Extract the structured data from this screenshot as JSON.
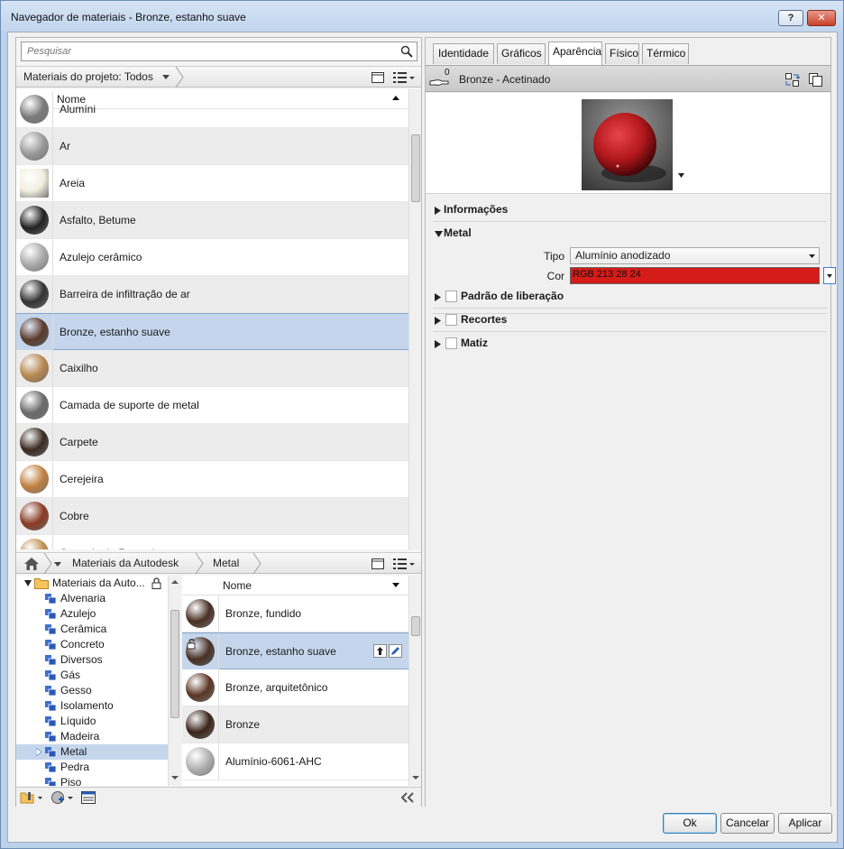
{
  "window": {
    "title": "Navegador de materiais - Bronze, estanho suave",
    "help_label": "?",
    "close_label": "✕"
  },
  "search": {
    "placeholder": "Pesquisar"
  },
  "project_bar": {
    "filter_label": "Materiais do projeto: Todos"
  },
  "project_list": {
    "header": "Nome",
    "items": [
      {
        "label": "Alumíni",
        "thumb": "#7a7a7a"
      },
      {
        "label": "Ar",
        "thumb": "#9a9a9a"
      },
      {
        "label": "Areia",
        "thumb": "#f2efe0"
      },
      {
        "label": "Asfalto, Betume",
        "thumb": "#222222"
      },
      {
        "label": "Azulejo cerâmico",
        "thumb": "#a9a9a9"
      },
      {
        "label": "Barreira de infiltração de ar",
        "thumb": "#333333"
      },
      {
        "label": "Bronze, estanho suave",
        "thumb": "#5a3a2a"
      },
      {
        "label": "Caixilho",
        "thumb": "#b88850"
      },
      {
        "label": "Camada de suporte de metal",
        "thumb": "#6a6a6a"
      },
      {
        "label": "Carpete",
        "thumb": "#3a2a22"
      },
      {
        "label": "Cerejeira",
        "thumb": "#c08040"
      },
      {
        "label": "Cobre",
        "thumb": "#8a3a22"
      },
      {
        "label": "Camada de Revestimento",
        "thumb": "#c09050"
      }
    ]
  },
  "library_bar": {
    "crumb1": "Materiais da Autodesk",
    "crumb2": "Metal"
  },
  "tree": {
    "root": "Materiais da Auto...",
    "items": [
      "Alvenaria",
      "Azulejo",
      "Cerâmica",
      "Concreto",
      "Diversos",
      "Gás",
      "Gesso",
      "Isolamento",
      "Líquido",
      "Madeira",
      "Metal",
      "Pedra",
      "Piso"
    ],
    "selected": "Metal"
  },
  "library_list": {
    "header": "Nome",
    "items": [
      {
        "label": "Bronze, fundido",
        "thumb": "#4a3024"
      },
      {
        "label": "Bronze, estanho suave",
        "thumb": "#4a3024"
      },
      {
        "label": "Bronze, arquitetônico",
        "thumb": "#5a3424"
      },
      {
        "label": "Bronze",
        "thumb": "#3a2418"
      },
      {
        "label": "Alumínio-6061-AHC",
        "thumb": "#b0b0b0"
      }
    ]
  },
  "tabs": [
    "Identidade",
    "Gráficos",
    "Aparência",
    "Físico",
    "Térmico"
  ],
  "active_tab": "Aparência",
  "asset": {
    "count": "0",
    "title": "Bronze - Acetinado"
  },
  "sections": {
    "info": "Informações",
    "metal": "Metal",
    "pattern": "Padrão de liberação",
    "cutouts": "Recortes",
    "tint": "Matiz"
  },
  "metal": {
    "type_label": "Tipo",
    "type_value": "Alumínio anodizado",
    "color_label": "Cor",
    "color_value": "RGB 213 28 24",
    "color_hex": "#d51c18"
  },
  "buttons": {
    "ok": "Ok",
    "cancel": "Cancelar",
    "apply": "Aplicar"
  },
  "colors": {
    "selection": "#c5d6ec",
    "accent": "#3a7bd5"
  }
}
